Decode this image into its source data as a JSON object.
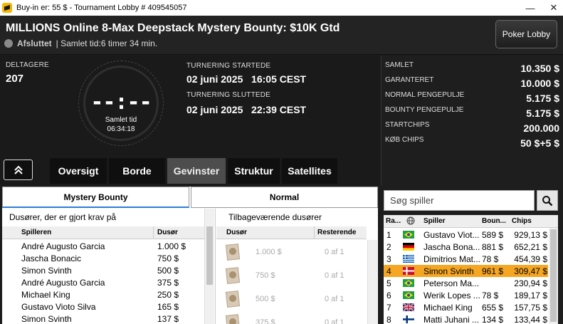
{
  "window": {
    "title": "Buy-in er: 55 $ - Tournament Lobby # 409545057",
    "minimize": "—",
    "close": "✕"
  },
  "header": {
    "tournament_name": "MILLIONS Online 8-Max Deepstack Mystery Bounty: $10K Gtd",
    "status": "Afsluttet",
    "elapsed": "| Samlet tid:6 timer  34 min.",
    "lobby_button": "Poker Lobby"
  },
  "info": {
    "entrants_label": "DELTAGERE",
    "entrants_value": "207",
    "clock_digits": "--:--",
    "clock_caption": "Samlet tid",
    "clock_time": "06:34:18",
    "started_label": "TURNERING STARTEDE",
    "started_value": "02 juni 2025   16:05 CEST",
    "ended_label": "TURNERING SLUTTEDE",
    "ended_value": "02 juni 2025   22:39 CEST"
  },
  "stats": [
    {
      "label": "SAMLET",
      "value": "10.350 $"
    },
    {
      "label": "GARANTERET",
      "value": "10.000 $"
    },
    {
      "label": "NORMAL PENGEPULJE",
      "value": "5.175 $"
    },
    {
      "label": "BOUNTY PENGEPULJE",
      "value": "5.175 $"
    },
    {
      "label": "STARTCHIPS",
      "value": "200.000"
    },
    {
      "label": "KØB CHIPS",
      "value": "50 $+5 $"
    }
  ],
  "tabs": [
    {
      "label": "Oversigt",
      "active": false
    },
    {
      "label": "Borde",
      "active": false
    },
    {
      "label": "Gevinster",
      "active": true
    },
    {
      "label": "Struktur",
      "active": false
    },
    {
      "label": "Satellites",
      "active": false
    }
  ],
  "subtabs": [
    {
      "label": "Mystery Bounty",
      "active": true
    },
    {
      "label": "Normal",
      "active": false
    }
  ],
  "claimed": {
    "heading": "Dusører, der er gjort krav på",
    "col_player": "Spilleren",
    "col_bounty": "Dusør",
    "rows": [
      {
        "player": "André Augusto Garcia",
        "bounty": "1.000 $"
      },
      {
        "player": "Jascha Bonacic",
        "bounty": "750 $"
      },
      {
        "player": "Simon Svinth",
        "bounty": "500 $"
      },
      {
        "player": "André Augusto Garcia",
        "bounty": "375 $"
      },
      {
        "player": "Michael King",
        "bounty": "250 $"
      },
      {
        "player": "Gustavo Vioto Silva",
        "bounty": "165 $"
      },
      {
        "player": "Simon Svinth",
        "bounty": "137 $"
      }
    ]
  },
  "remaining": {
    "heading": "Tilbageværende dusører",
    "col_bounty": "Dusør",
    "col_remaining": "Resterende",
    "rows": [
      {
        "bounty": "1.000 $",
        "remaining": "0 af 1"
      },
      {
        "bounty": "750 $",
        "remaining": "0 af 1"
      },
      {
        "bounty": "500 $",
        "remaining": "0 af 1"
      },
      {
        "bounty": "375 $",
        "remaining": "0 af 1"
      }
    ]
  },
  "players": {
    "search_placeholder": "Søg spiller",
    "col_rank": "Ra...",
    "col_player": "Spiller",
    "col_bounty": "Boun...",
    "col_chips": "Chips",
    "rows": [
      {
        "rank": "1",
        "flag": "brazil",
        "name": "Gustavo Viot...",
        "bounty": "589 $",
        "chips": "929,13 $"
      },
      {
        "rank": "2",
        "flag": "germany",
        "name": "Jascha Bona...",
        "bounty": "881 $",
        "chips": "652,21 $"
      },
      {
        "rank": "3",
        "flag": "greece",
        "name": "Dimitrios Mat...",
        "bounty": "78 $",
        "chips": "454,39 $"
      },
      {
        "rank": "4",
        "flag": "denmark",
        "name": "Simon Svinth",
        "bounty": "961 $",
        "chips": "309,47 $",
        "highlight": true
      },
      {
        "rank": "5",
        "flag": "brazil",
        "name": "Peterson Ma...",
        "bounty": "",
        "chips": "230,94 $"
      },
      {
        "rank": "6",
        "flag": "brazil",
        "name": "Werik Lopes ...",
        "bounty": "78 $",
        "chips": "189,17 $"
      },
      {
        "rank": "7",
        "flag": "uk",
        "name": "Michael King",
        "bounty": "655 $",
        "chips": "157,75 $"
      },
      {
        "rank": "8",
        "flag": "finland",
        "name": "Matti Juhani ...",
        "bounty": "134 $",
        "chips": "133,44 $"
      }
    ]
  },
  "colors": {
    "highlight": "#f5a623",
    "active_tab": "#4d4d4d",
    "tab_underline": "#2c7dd6"
  }
}
